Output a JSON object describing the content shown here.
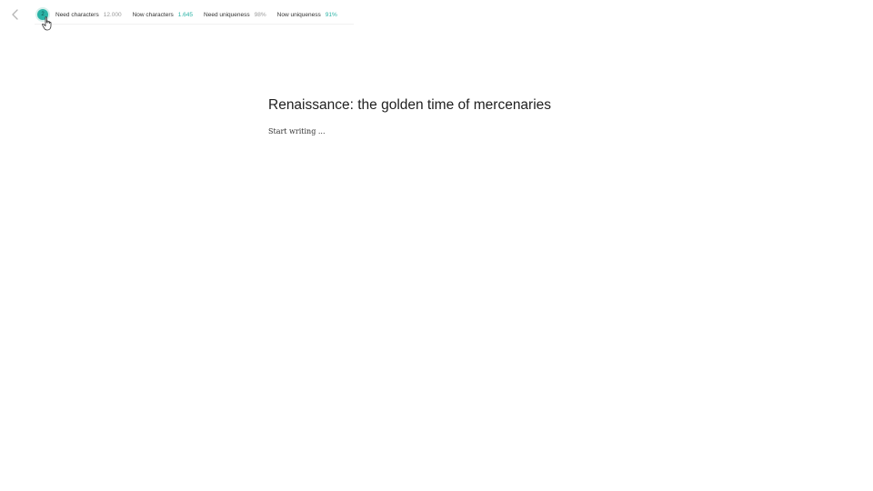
{
  "toolbar": {
    "back_icon": "chevron-left-icon",
    "status_badge": "2",
    "accent_color": "#2ab3a6",
    "stats": [
      {
        "label": "Need characters",
        "value": "12.000",
        "accent": false
      },
      {
        "label": "Now characters",
        "value": "1.645",
        "accent": true
      },
      {
        "label": "Need uniqueness",
        "value": "98%",
        "accent": false
      },
      {
        "label": "Now uniqueness",
        "value": "91%",
        "accent": true
      }
    ]
  },
  "document": {
    "title": "Renaissance: the golden time of mercenaries",
    "body_placeholder": "Start writing ..."
  },
  "pointer": {
    "icon": "hand-pointer-icon"
  }
}
